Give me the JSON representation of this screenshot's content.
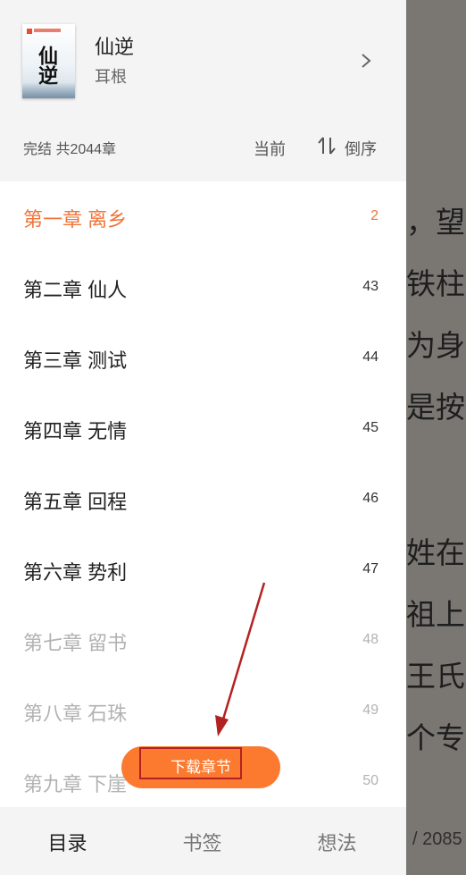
{
  "book": {
    "title": "仙逆",
    "author": "耳根",
    "cover_text": "仙逆"
  },
  "summary": {
    "status": "完结 共2044章",
    "current_label": "当前",
    "sort_label": "倒序"
  },
  "chapters": [
    {
      "title": "第一章 离乡",
      "num": "2",
      "state": "active"
    },
    {
      "title": "第二章 仙人",
      "num": "43",
      "state": "normal"
    },
    {
      "title": "第三章 测试",
      "num": "44",
      "state": "normal"
    },
    {
      "title": "第四章 无情",
      "num": "45",
      "state": "normal"
    },
    {
      "title": "第五章 回程",
      "num": "46",
      "state": "normal"
    },
    {
      "title": "第六章 势利",
      "num": "47",
      "state": "normal"
    },
    {
      "title": "第七章 留书",
      "num": "48",
      "state": "faded"
    },
    {
      "title": "第八章 石珠",
      "num": "49",
      "state": "faded"
    },
    {
      "title": "第九章 下崖",
      "num": "50",
      "state": "faded"
    }
  ],
  "download_label": "下载章节",
  "tabs": [
    {
      "label": "目录",
      "selected": true
    },
    {
      "label": "书签",
      "selected": false
    },
    {
      "label": "想法",
      "selected": false
    }
  ],
  "reader": {
    "lines": [
      "，望",
      "铁柱",
      "为身",
      "是按",
      "姓在",
      "祖上",
      "王氏",
      "个专"
    ],
    "page_indicator": "/ 2085"
  },
  "colors": {
    "accent": "#f07438",
    "download": "#fb7a30",
    "annotation": "#b32222"
  }
}
